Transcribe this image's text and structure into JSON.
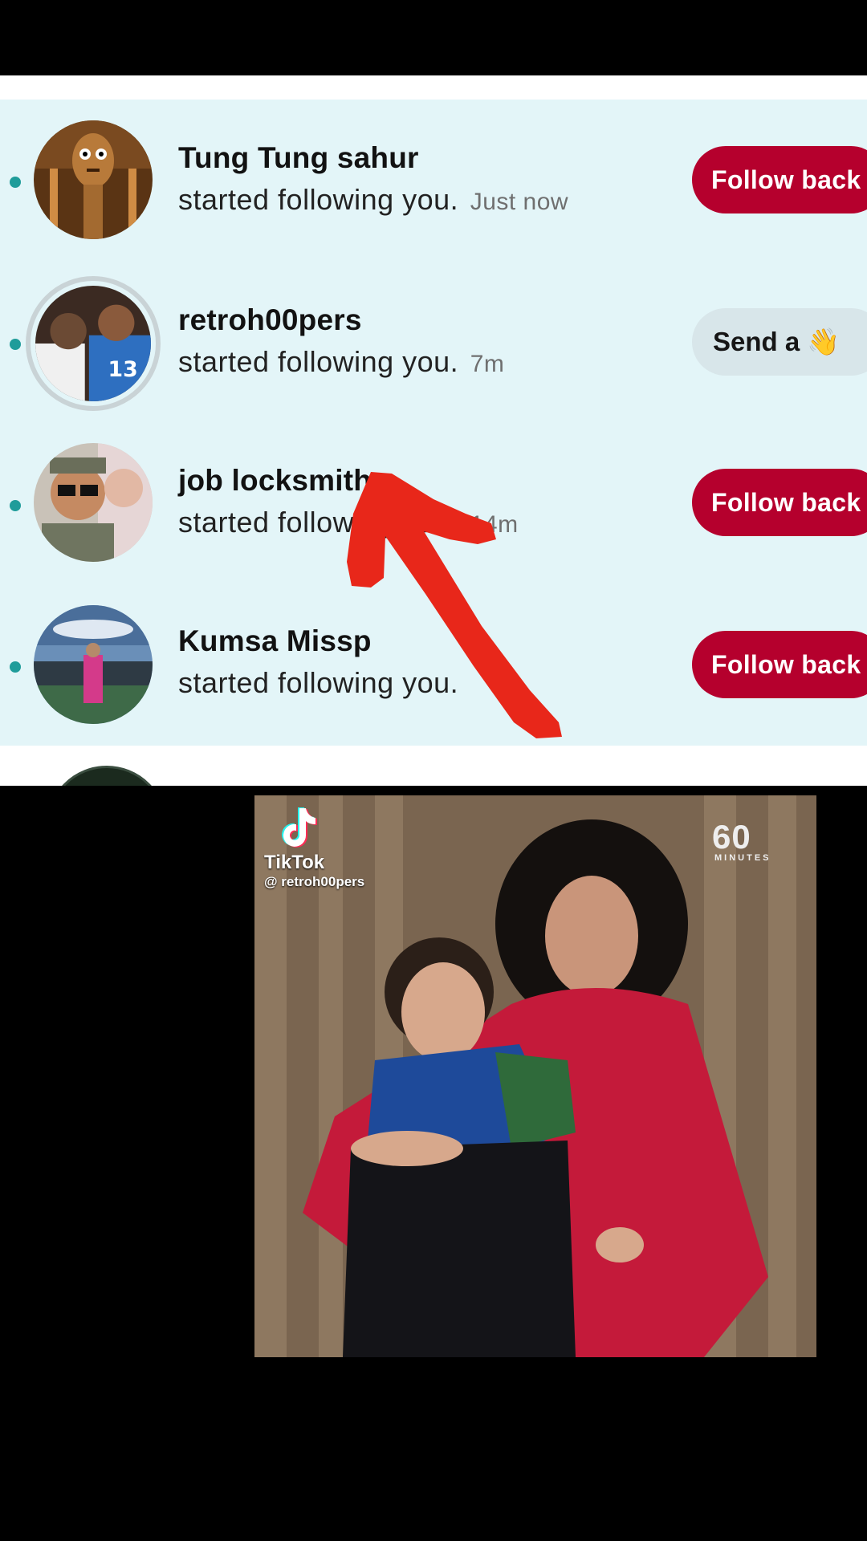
{
  "notifications": [
    {
      "username": "Tung Tung sahur",
      "action": "started following you.",
      "time": "Just now",
      "button": "Follow back"
    },
    {
      "username": "retroh00pers",
      "action": "started following you.",
      "time": "7m",
      "button": "Send a",
      "button_emoji": "👋"
    },
    {
      "username": "job locksmith",
      "action": "started following you.",
      "time": "14m",
      "button": "Follow back"
    },
    {
      "username": "Kumsa Missp",
      "action": "started following you.",
      "time": "",
      "button": "Follow back"
    }
  ],
  "video": {
    "platform": "TikTok",
    "handle": "@ retroh00pers",
    "watermark_top": "60",
    "watermark_bottom": "MINUTES"
  },
  "colors": {
    "panel_bg": "#e3f5f8",
    "follow_button": "#b5002d",
    "unread_dot": "#1f9c9a",
    "annotation_arrow": "#e8271a"
  }
}
